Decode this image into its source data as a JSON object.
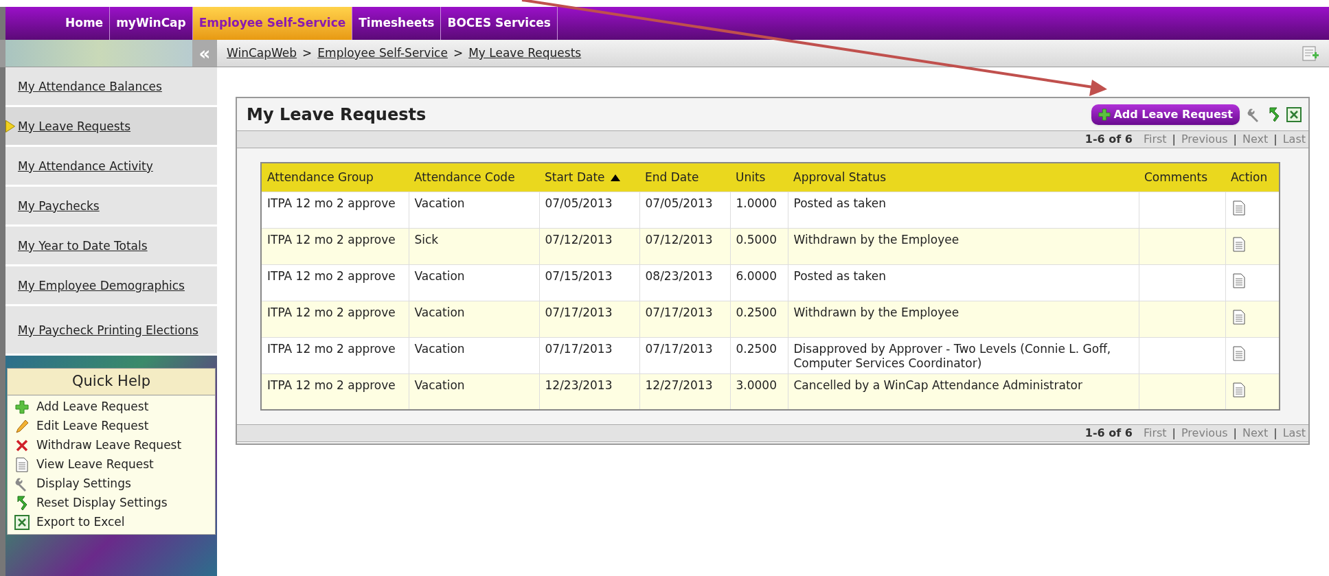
{
  "top_nav": [
    {
      "label": "Home",
      "selected": false
    },
    {
      "label": "myWinCap",
      "selected": false
    },
    {
      "label": "Employee Self-Service",
      "selected": true
    },
    {
      "label": "Timesheets",
      "selected": false
    },
    {
      "label": "BOCES Services",
      "selected": false
    }
  ],
  "collapse_label": "«",
  "breadcrumb": {
    "items": [
      "WinCapWeb",
      "Employee Self-Service",
      "My Leave Requests"
    ],
    "separator": ">"
  },
  "sidebar": {
    "items": [
      {
        "label": "My Attendance Balances",
        "selected": false
      },
      {
        "label": "My Leave Requests",
        "selected": true
      },
      {
        "label": "My Attendance Activity",
        "selected": false
      },
      {
        "label": "My Paychecks",
        "selected": false
      },
      {
        "label": "My Year to Date Totals",
        "selected": false
      },
      {
        "label": "My Employee Demographics",
        "selected": false
      },
      {
        "label": "My Paycheck Printing Elections",
        "selected": false
      }
    ]
  },
  "quick_help": {
    "title": "Quick Help",
    "items": [
      {
        "kind": "add",
        "label": "Add Leave Request"
      },
      {
        "kind": "edit",
        "label": "Edit Leave Request"
      },
      {
        "kind": "withdraw",
        "label": "Withdraw Leave Request"
      },
      {
        "kind": "view",
        "label": "View Leave Request"
      },
      {
        "kind": "settings",
        "label": "Display Settings"
      },
      {
        "kind": "reset",
        "label": "Reset Display Settings"
      },
      {
        "kind": "excel",
        "label": "Export to Excel"
      }
    ]
  },
  "panel": {
    "title": "My Leave Requests",
    "add_button": "Add Leave Request"
  },
  "pager_top": {
    "summary": "1-6 of 6",
    "separator": "|",
    "links": [
      {
        "label": "First",
        "disabled": true
      },
      {
        "label": "Previous",
        "disabled": true
      },
      {
        "label": "Next",
        "disabled": true
      },
      {
        "label": "Last",
        "disabled": true
      }
    ]
  },
  "table": {
    "columns": [
      {
        "label": "Attendance Group",
        "sorted": false
      },
      {
        "label": "Attendance Code",
        "sorted": false
      },
      {
        "label": "Start Date",
        "sorted": true
      },
      {
        "label": "End Date",
        "sorted": false
      },
      {
        "label": "Units",
        "sorted": false
      },
      {
        "label": "Approval Status",
        "sorted": false
      },
      {
        "label": "Comments",
        "sorted": false
      },
      {
        "label": "Action",
        "sorted": false
      }
    ],
    "rows": [
      [
        "ITPA 12 mo 2 approve",
        "Vacation",
        "07/05/2013",
        "07/05/2013",
        "1.0000",
        "Posted as taken",
        ""
      ],
      [
        "ITPA 12 mo 2 approve",
        "Sick",
        "07/12/2013",
        "07/12/2013",
        "0.5000",
        "Withdrawn by the Employee",
        ""
      ],
      [
        "ITPA 12 mo 2 approve",
        "Vacation",
        "07/15/2013",
        "08/23/2013",
        "6.0000",
        "Posted as taken",
        ""
      ],
      [
        "ITPA 12 mo 2 approve",
        "Vacation",
        "07/17/2013",
        "07/17/2013",
        "0.2500",
        "Withdrawn by the Employee",
        ""
      ],
      [
        "ITPA 12 mo 2 approve",
        "Vacation",
        "07/17/2013",
        "07/17/2013",
        "0.2500",
        "Disapproved by Approver - Two Levels (Connie L. Goff, Computer Services Coordinator)",
        ""
      ],
      [
        "ITPA 12 mo 2 approve",
        "Vacation",
        "12/23/2013",
        "12/27/2013",
        "3.0000",
        "Cancelled by a WinCap Attendance Administrator",
        ""
      ]
    ]
  },
  "pager_bottom": {
    "summary": "1-6 of 6",
    "separator": "|",
    "links": [
      {
        "label": "First",
        "disabled": true
      },
      {
        "label": "Previous",
        "disabled": true
      },
      {
        "label": "Next",
        "disabled": true
      },
      {
        "label": "Last",
        "disabled": true
      }
    ]
  }
}
